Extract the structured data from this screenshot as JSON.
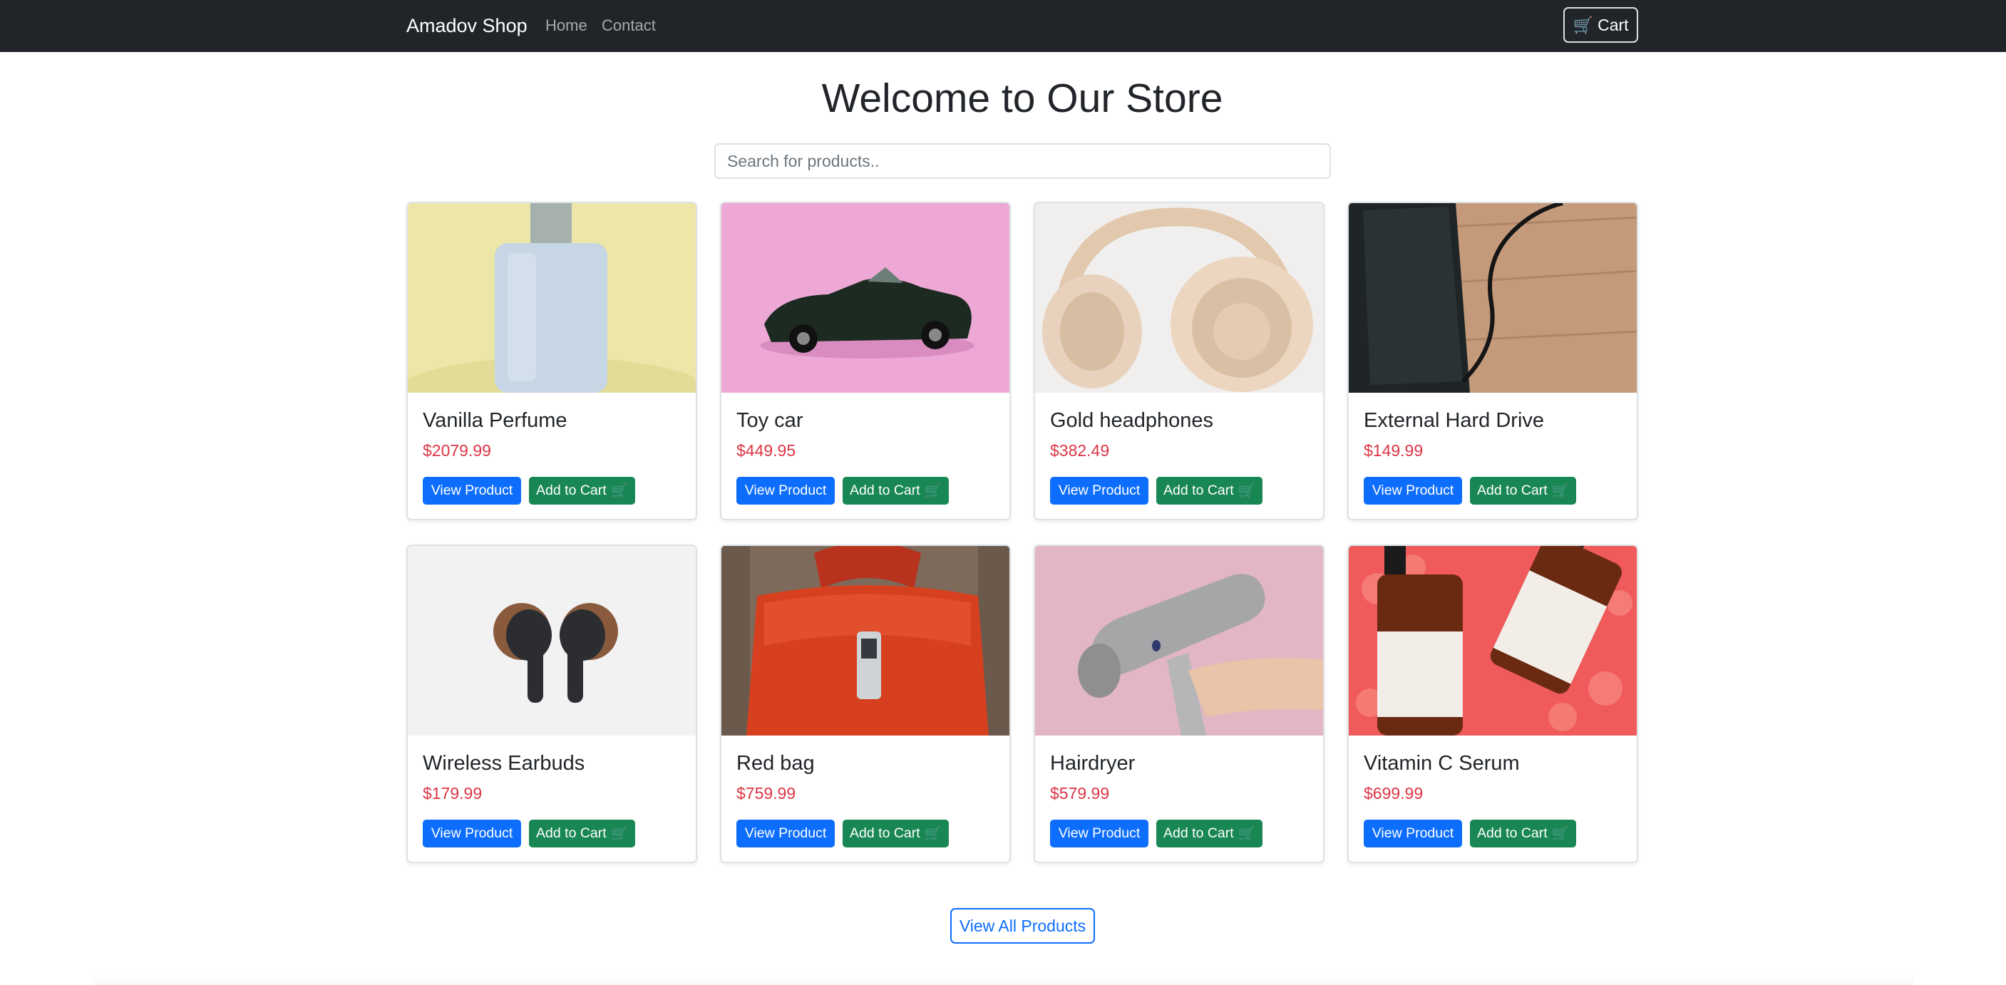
{
  "navbar": {
    "brand": "Amadov Shop",
    "links": [
      "Home",
      "Contact"
    ],
    "cart_icon": "🛒",
    "cart_label": "Cart"
  },
  "page": {
    "title": "Welcome to Our Store"
  },
  "search": {
    "placeholder": "Search for products.."
  },
  "products": [
    {
      "name": "Vanilla Perfume",
      "price": "$2079.99",
      "image_icon": "perfume-image"
    },
    {
      "name": "Toy car",
      "price": "$449.95",
      "image_icon": "toy-car-image"
    },
    {
      "name": "Gold headphones",
      "price": "$382.49",
      "image_icon": "headphones-image"
    },
    {
      "name": "External Hard Drive",
      "price": "$149.99",
      "image_icon": "hard-drive-image"
    },
    {
      "name": "Wireless Earbuds",
      "price": "$179.99",
      "image_icon": "earbuds-image"
    },
    {
      "name": "Red bag",
      "price": "$759.99",
      "image_icon": "red-bag-image"
    },
    {
      "name": "Hairdryer",
      "price": "$579.99",
      "image_icon": "hairdryer-image"
    },
    {
      "name": "Vitamin C Serum",
      "price": "$699.99",
      "image_icon": "serum-image"
    }
  ],
  "buttons": {
    "view_label": "View Product",
    "add_label": "Add to Cart",
    "add_icon": "🛒",
    "view_all_label": "View All Products"
  },
  "colors": {
    "navbar_bg": "#212529",
    "primary": "#0d6efd",
    "success": "#198754",
    "price": "#dc3545"
  }
}
